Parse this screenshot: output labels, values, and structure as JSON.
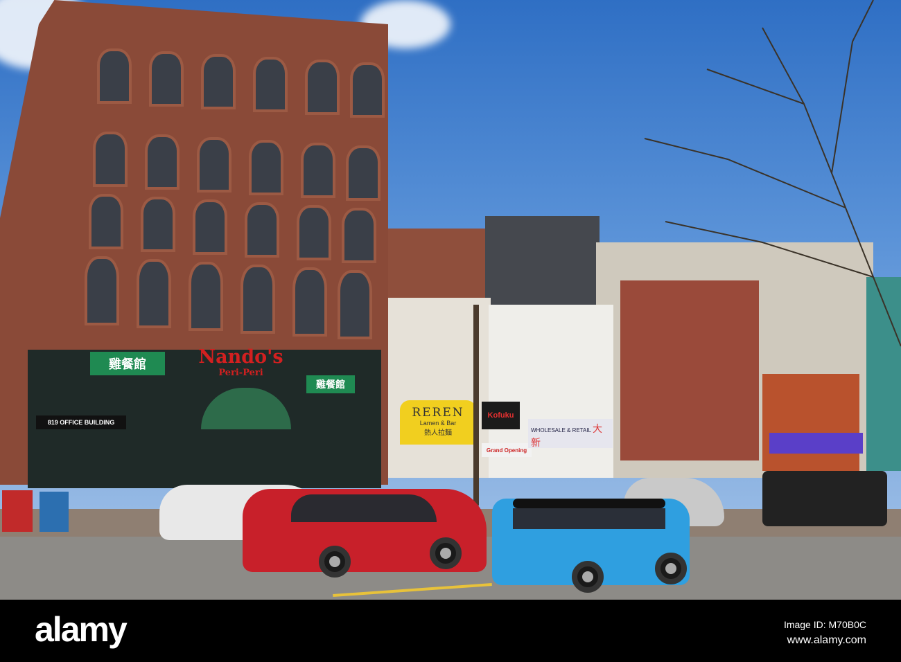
{
  "signs": {
    "chinese_left": "雞餐館",
    "nandos": "Nando's",
    "nandos_sub": "Peri-Peri",
    "chinese_right": "雞餐館",
    "office": "819 OFFICE BUILDING",
    "reren": "REREN",
    "reren_sub": "Lamen & Bar",
    "reren_chinese": "熱人拉麵",
    "kofuku": "Kofuku",
    "wholesale": "WHOLESALE & RETAIL",
    "wholesale_chinese": "大新",
    "grand_opening": "Grand Opening"
  },
  "watermark": {
    "logo": "alamy",
    "image_id": "Image ID: M70B0C",
    "url": "www.alamy.com"
  },
  "colors": {
    "sky": "#4f88d2",
    "brick": "#8a4a38",
    "red_car": "#c8202a",
    "blue_car": "#2f9fe0",
    "awning": "#f1cf1f"
  }
}
